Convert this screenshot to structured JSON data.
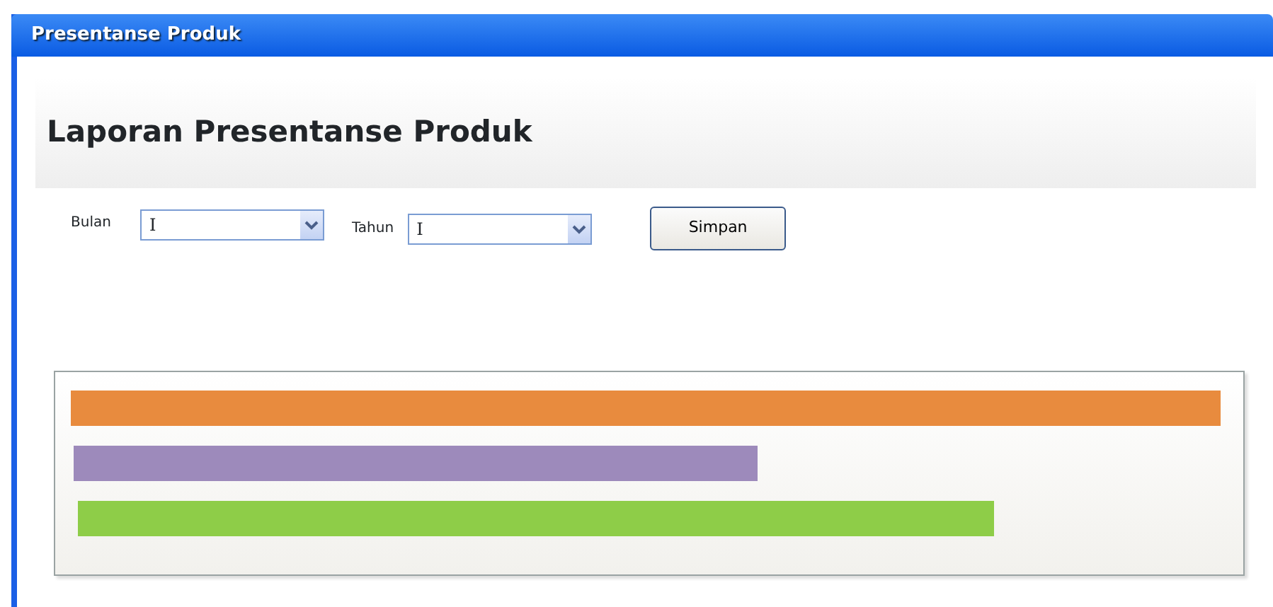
{
  "window": {
    "title": "Presentanse Produk"
  },
  "heading": "Laporan Presentanse Produk",
  "filters": [
    {
      "label": "Bulan",
      "value": "I"
    },
    {
      "label": "Tahun",
      "value": "I"
    }
  ],
  "save_button": "Simpan",
  "bars": [
    {
      "color": "#e88b3e"
    },
    {
      "color": "#9d8abb"
    },
    {
      "color": "#8ecd48"
    }
  ]
}
